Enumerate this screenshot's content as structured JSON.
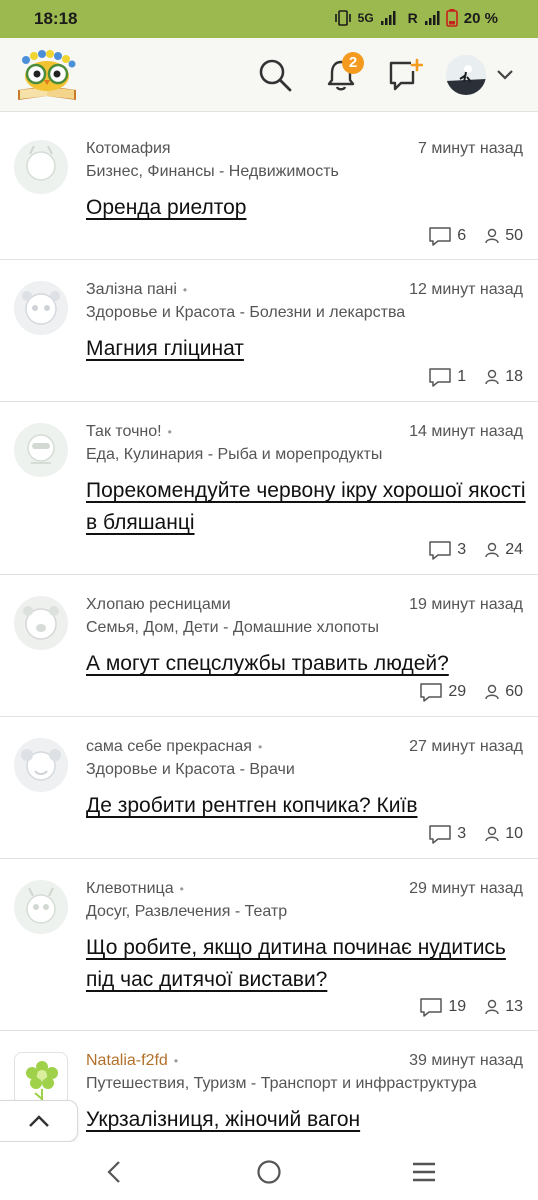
{
  "status_bar": {
    "time": "18:18",
    "network": "5G",
    "roaming": "R",
    "battery": "20 %"
  },
  "header": {
    "logo_icon": "owl-book-logo-icon",
    "search_icon": "search-icon",
    "bell_icon": "bell-icon",
    "notification_count": "2",
    "compose_icon": "new-message-icon",
    "profile_chevron_icon": "chevron-down-icon"
  },
  "posts": [
    {
      "author": "Котомафия",
      "time": "7 минут назад",
      "category": "Бизнес, Финансы - Недвижимость",
      "title": "Оренда риелтор",
      "comments": "6",
      "views": "50"
    },
    {
      "author": "Залізна пані",
      "time": "12 минут назад",
      "category": "Здоровье и Красота - Болезни и лекарства",
      "title": "Магния гліцинат",
      "comments": "1",
      "views": "18"
    },
    {
      "author": "Так точно!",
      "time": "14 минут назад",
      "category": "Еда, Кулинария - Рыба и морепродукты",
      "title": "Порекомендуйте червону ікру хорошої якості в бляшанці",
      "comments": "3",
      "views": "24"
    },
    {
      "author": "Хлопаю ресницами",
      "time": "19 минут назад",
      "category": "Семья, Дом, Дети - Домашние хлопоты",
      "title": "А могут спецслужбы травить людей?",
      "comments": "29",
      "views": "60"
    },
    {
      "author": "сама себе прекрасная",
      "time": "27 минут назад",
      "category": "Здоровье и Красота - Врачи",
      "title": "Де зробити рентген копчика? Київ",
      "comments": "3",
      "views": "10"
    },
    {
      "author": "Клевотница",
      "time": "29 минут назад",
      "category": "Досуг, Развлечения - Театр",
      "title": "Що робите, якщо дитина починає нудитись під час дитячої вистави?",
      "comments": "19",
      "views": "13"
    },
    {
      "author": "Natalia-f2fd",
      "time": "39 минут назад",
      "category": "Путешествия, Туризм - Транспорт и инфраструктура",
      "title": "Укрзалізниця, жіночий вагон"
    }
  ],
  "colors": {
    "status_bar": "#9cb94f",
    "badge": "#f39a1f",
    "author_highlight": "#b3702a"
  }
}
